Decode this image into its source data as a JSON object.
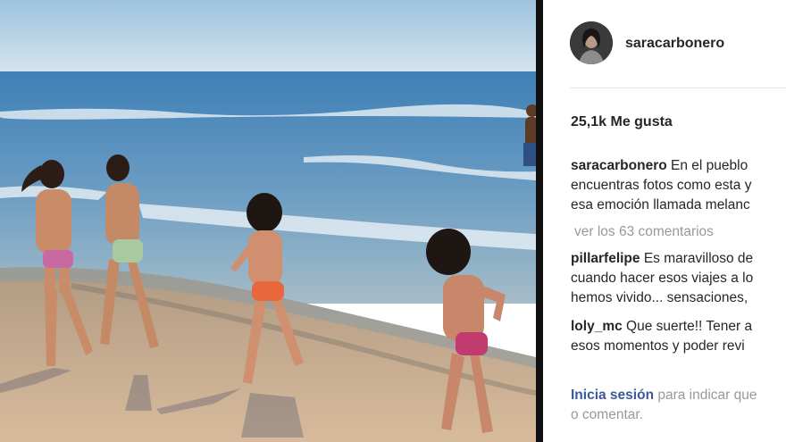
{
  "post": {
    "username": "saracarbonero",
    "likes": "25,1k Me gusta",
    "caption": {
      "user": "saracarbonero",
      "lines": [
        "En el pueblo",
        "encuentras fotos como esta y",
        "esa emoción llamada melanc"
      ]
    },
    "view_all": "ver los 63 comentarios",
    "comments": [
      {
        "user": "pillarfelipe",
        "lines": [
          "Es maravilloso de",
          "cuando hacer esos viajes a lo",
          "hemos vivido... sensaciones,"
        ]
      },
      {
        "user": "loly_mc",
        "lines": [
          "Que suerte!! Tener a",
          "esos momentos y poder revi"
        ]
      }
    ],
    "login": {
      "link": "Inicia sesión",
      "rest1": " para indicar que",
      "rest2": "o comentar."
    }
  },
  "colors": {
    "text": "#262626",
    "muted": "#999999",
    "link": "#3b5998",
    "divider": "#111111"
  }
}
